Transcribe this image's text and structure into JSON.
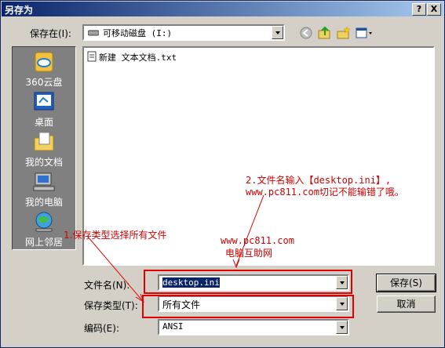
{
  "window": {
    "title": "另存为",
    "help_glyph": "?",
    "close_glyph": "X"
  },
  "save_in": {
    "label": "保存在(I):",
    "value": "可移动磁盘 (I:)"
  },
  "toolbar": {
    "icons": [
      "back-icon",
      "up-folder-icon",
      "new-folder-icon",
      "view-menu-icon"
    ]
  },
  "places": [
    {
      "label": "360云盘",
      "icon": "cloud-icon"
    },
    {
      "label": "桌面",
      "icon": "desktop-icon"
    },
    {
      "label": "我的文档",
      "icon": "folder-documents-icon"
    },
    {
      "label": "我的电脑",
      "icon": "computer-icon"
    },
    {
      "label": "网上邻居",
      "icon": "network-icon"
    }
  ],
  "files": [
    {
      "name": "新建 文本文档.txt",
      "icon": "text-file-icon"
    }
  ],
  "filename": {
    "label": "文件名(N):",
    "value": "desktop.ini"
  },
  "filetype": {
    "label": "保存类型(T):",
    "value": "所有文件"
  },
  "encoding": {
    "label": "编码(E):",
    "value": "ANSI"
  },
  "buttons": {
    "save": "保存(S)",
    "cancel": "取消"
  },
  "annotations": {
    "note2_line1": "2.文件名输入【desktop.ini】,",
    "note2_line2": "www.pc811.com切记不能输错了哦。",
    "note1": "1.保存类型选择所有文件",
    "watermark_url": "www.pc811.com",
    "watermark_name": "电脑互助网"
  },
  "colors": {
    "annotation": "#e00000",
    "titlebar": "#0a246a"
  }
}
